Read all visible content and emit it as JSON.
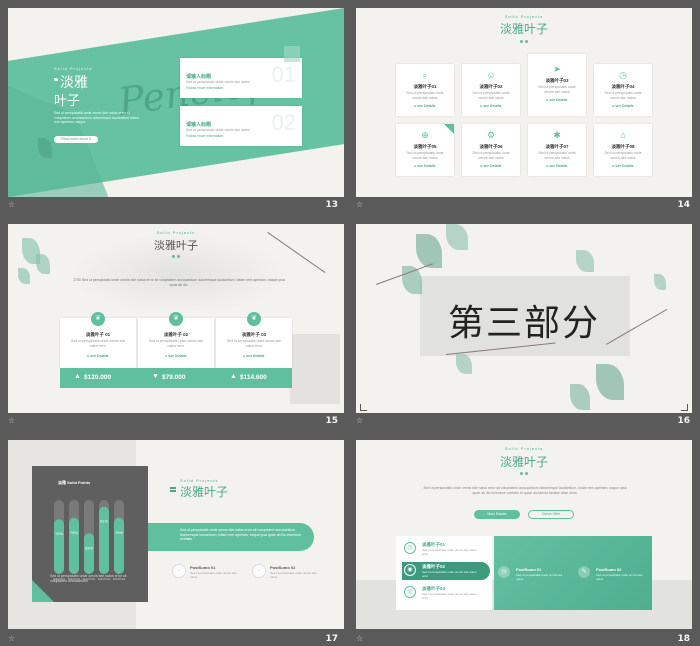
{
  "colors": {
    "accent": "#5fbf9f",
    "background": "#5a5a5a",
    "slide": "#f3f2ef"
  },
  "slide_icon": "slide-icon",
  "s13": {
    "num": "13",
    "sub": "Solid Projects",
    "title1": "淡雅",
    "title2": "叶子",
    "script": "Penelope",
    "desc": "Sed ut perspiciatis unde omnis iste natus error sit voluptatem accusantium doloremque laudantium totam rem aperiam, eaque.",
    "btn": "Read more about it",
    "cards": [
      {
        "title": "请输入标题",
        "text": "Sed ut perspiciatis unde omnis iste natus",
        "more": "Follow more information",
        "bg": "01"
      },
      {
        "title": "请输入标题",
        "text": "Sed ut perspiciatis unde omnis iste natus",
        "more": "Follow more information",
        "bg": "02"
      }
    ]
  },
  "s14": {
    "num": "14",
    "sub": "Solid Projects",
    "title": "淡雅叶子",
    "cards": [
      {
        "title": "淡雅叶子01",
        "text": "Sed ut perspiciatis unde omnis iste natus",
        "more": "▸ see Details",
        "icon": "search-icon"
      },
      {
        "title": "淡雅叶子02",
        "text": "Sed ut perspiciatis unde omnis iste natus",
        "more": "▸ see Details",
        "icon": "user-icon"
      },
      {
        "title": "淡雅叶子03",
        "text": "Sed ut perspiciatis unde omnis iste natus",
        "more": "▸ see Details",
        "icon": "send-icon"
      },
      {
        "title": "淡雅叶子04",
        "text": "Sed ut perspiciatis unde omnis iste natus",
        "more": "▸ see Details",
        "icon": "clock-icon"
      },
      {
        "title": "淡雅叶子05",
        "text": "Sed ut perspiciatis unde omnis iste natus",
        "more": "▸ see Details",
        "icon": "globe-icon"
      },
      {
        "title": "淡雅叶子06",
        "text": "Sed ut perspiciatis unde omnis iste natus",
        "more": "▸ see Details",
        "icon": "gears-icon"
      },
      {
        "title": "淡雅叶子07",
        "text": "Sed ut perspiciatis unde omnis iste natus",
        "more": "▸ see Details",
        "icon": "bulb-icon"
      },
      {
        "title": "淡雅叶子08",
        "text": "Sed ut perspiciatis unde omnis iste natus",
        "more": "▸ see Details",
        "icon": "home-icon"
      }
    ]
  },
  "s15": {
    "num": "15",
    "sub": "Solid Projects",
    "title": "淡雅叶子",
    "desc": "2700 Sed ut perspiciatis unde omnis iste natus error sit voluptatem accusantium doloremque laudantium, totam rem aperiam, eaque ipsa quae ab illo.",
    "cards": [
      {
        "title": "淡雅叶子 01",
        "text": "Sed ut perspiciatis unde omnis iste natus error",
        "more": "▸ see Details",
        "amount": "$120.000",
        "arrow": "▲"
      },
      {
        "title": "淡雅叶子 02",
        "text": "Sed ut perspiciatis unde omnis iste natus error",
        "more": "▸ see Details",
        "amount": "$79.000",
        "arrow": "▼"
      },
      {
        "title": "淡雅叶子 03",
        "text": "Sed ut perspiciatis unde omnis iste natus error",
        "more": "▸ see Details",
        "amount": "$114.600",
        "arrow": "▲"
      }
    ]
  },
  "s16": {
    "num": "16",
    "title": "第三部分"
  },
  "s17": {
    "num": "17",
    "sub": "Solid Projects",
    "title": "淡雅叶子",
    "chart_title": "淡雅 Solid Points",
    "bars": [
      {
        "value": 74,
        "label": "74%",
        "name": "Solid Point"
      },
      {
        "value": 76,
        "label": "76%",
        "name": "Solid Point"
      },
      {
        "value": 55,
        "label": "55%",
        "name": "Solid Point"
      },
      {
        "value": 91,
        "label": "91%",
        "name": "Solid Point"
      },
      {
        "value": 76,
        "label": "76%",
        "name": "Solid Point"
      }
    ],
    "chart_desc": "Sed ut perspiciatis unde omnis iste natus error sit voluptatem accusantium",
    "banner": "Sed ut perspiciatis unde omnis iste natus error sit voluptatem accusantium doloremque laudantium, totam rem aperiam, eaque ipsa quae ab illo inventore veritatis.",
    "points": [
      {
        "title": "PostSumo 01",
        "text": "Sed ut perspiciatis unde omnis iste natus"
      },
      {
        "title": "PostSumo 02",
        "text": "Sed ut perspiciatis unde omnis iste natus"
      }
    ]
  },
  "s18": {
    "num": "18",
    "sub": "Solid Projects",
    "title": "淡雅叶子",
    "desc": "Sed ut perspiciatis unde omnis iste natus error sit voluptatem accusantium doloremque laudantium, totam rem aperiam, eaque ipsa quae ab illo inventore veritatis et quasi architecto beatae vitae dicta.",
    "btn1": "Main Details",
    "btn2": "Check Offer",
    "items": [
      {
        "title": "淡雅叶子01",
        "text": "Sed ut perspiciatis unde omnis iste natus error"
      },
      {
        "title": "淡雅叶子02",
        "text": "Sed ut perspiciatis unde omnis iste natus error"
      },
      {
        "title": "淡雅叶子03",
        "text": "Sed ut perspiciatis unde omnis iste natus error"
      }
    ],
    "posts": [
      {
        "title": "PostSumo 01",
        "text": "Sed ut perspiciatis unde omnis iste natus"
      },
      {
        "title": "PostSumo 02",
        "text": "Sed ut perspiciatis unde omnis iste natus"
      }
    ]
  },
  "chart_data": {
    "type": "bar",
    "title": "淡雅 Solid Points",
    "categories": [
      "Solid Point",
      "Solid Point",
      "Solid Point",
      "Solid Point",
      "Solid Point"
    ],
    "values": [
      74,
      76,
      55,
      91,
      76
    ],
    "ylim": [
      0,
      100
    ]
  }
}
